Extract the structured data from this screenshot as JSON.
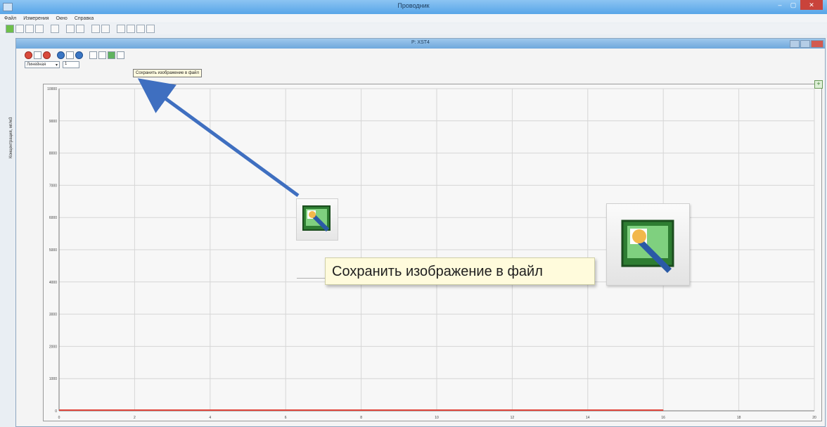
{
  "app": {
    "title": "Проводник"
  },
  "menu": {
    "items": [
      "Файл",
      "Измерения",
      "Окно",
      "Справка"
    ]
  },
  "window_controls": {
    "minimize": "–",
    "maximize": "▢",
    "close": "✕"
  },
  "child": {
    "title": "Р: XST4"
  },
  "inner_toolbar": {
    "combo_value": "Линейная",
    "spin_value": "1",
    "tooltip_small": "Сохранить изображение в файл"
  },
  "chart_data": {
    "type": "line",
    "ylabel": "Концентрация, мг/м3",
    "yticks": [
      "10000",
      "9000",
      "8000",
      "7000",
      "6000",
      "5000",
      "4000",
      "3000",
      "2000",
      "1000",
      "0"
    ],
    "xticks": [
      "0",
      "2",
      "4",
      "6",
      "8",
      "10",
      "12",
      "14",
      "16",
      "18",
      "20"
    ],
    "ylim": [
      0,
      10000
    ],
    "xlim": [
      0,
      20
    ],
    "grid": true,
    "series": [
      {
        "color": "#e0453a",
        "x": [
          0,
          16
        ],
        "y": [
          0,
          0
        ]
      }
    ]
  },
  "callout": {
    "tooltip_text": "Сохранить изображение в файл",
    "arrow_color": "#3f6fc0"
  },
  "colors": {
    "titlebar": "#6fb2ee",
    "close_red": "#c9433b",
    "series_red": "#e0453a",
    "arrow_blue": "#3f6fc0",
    "tooltip_bg": "#fffbdc"
  }
}
